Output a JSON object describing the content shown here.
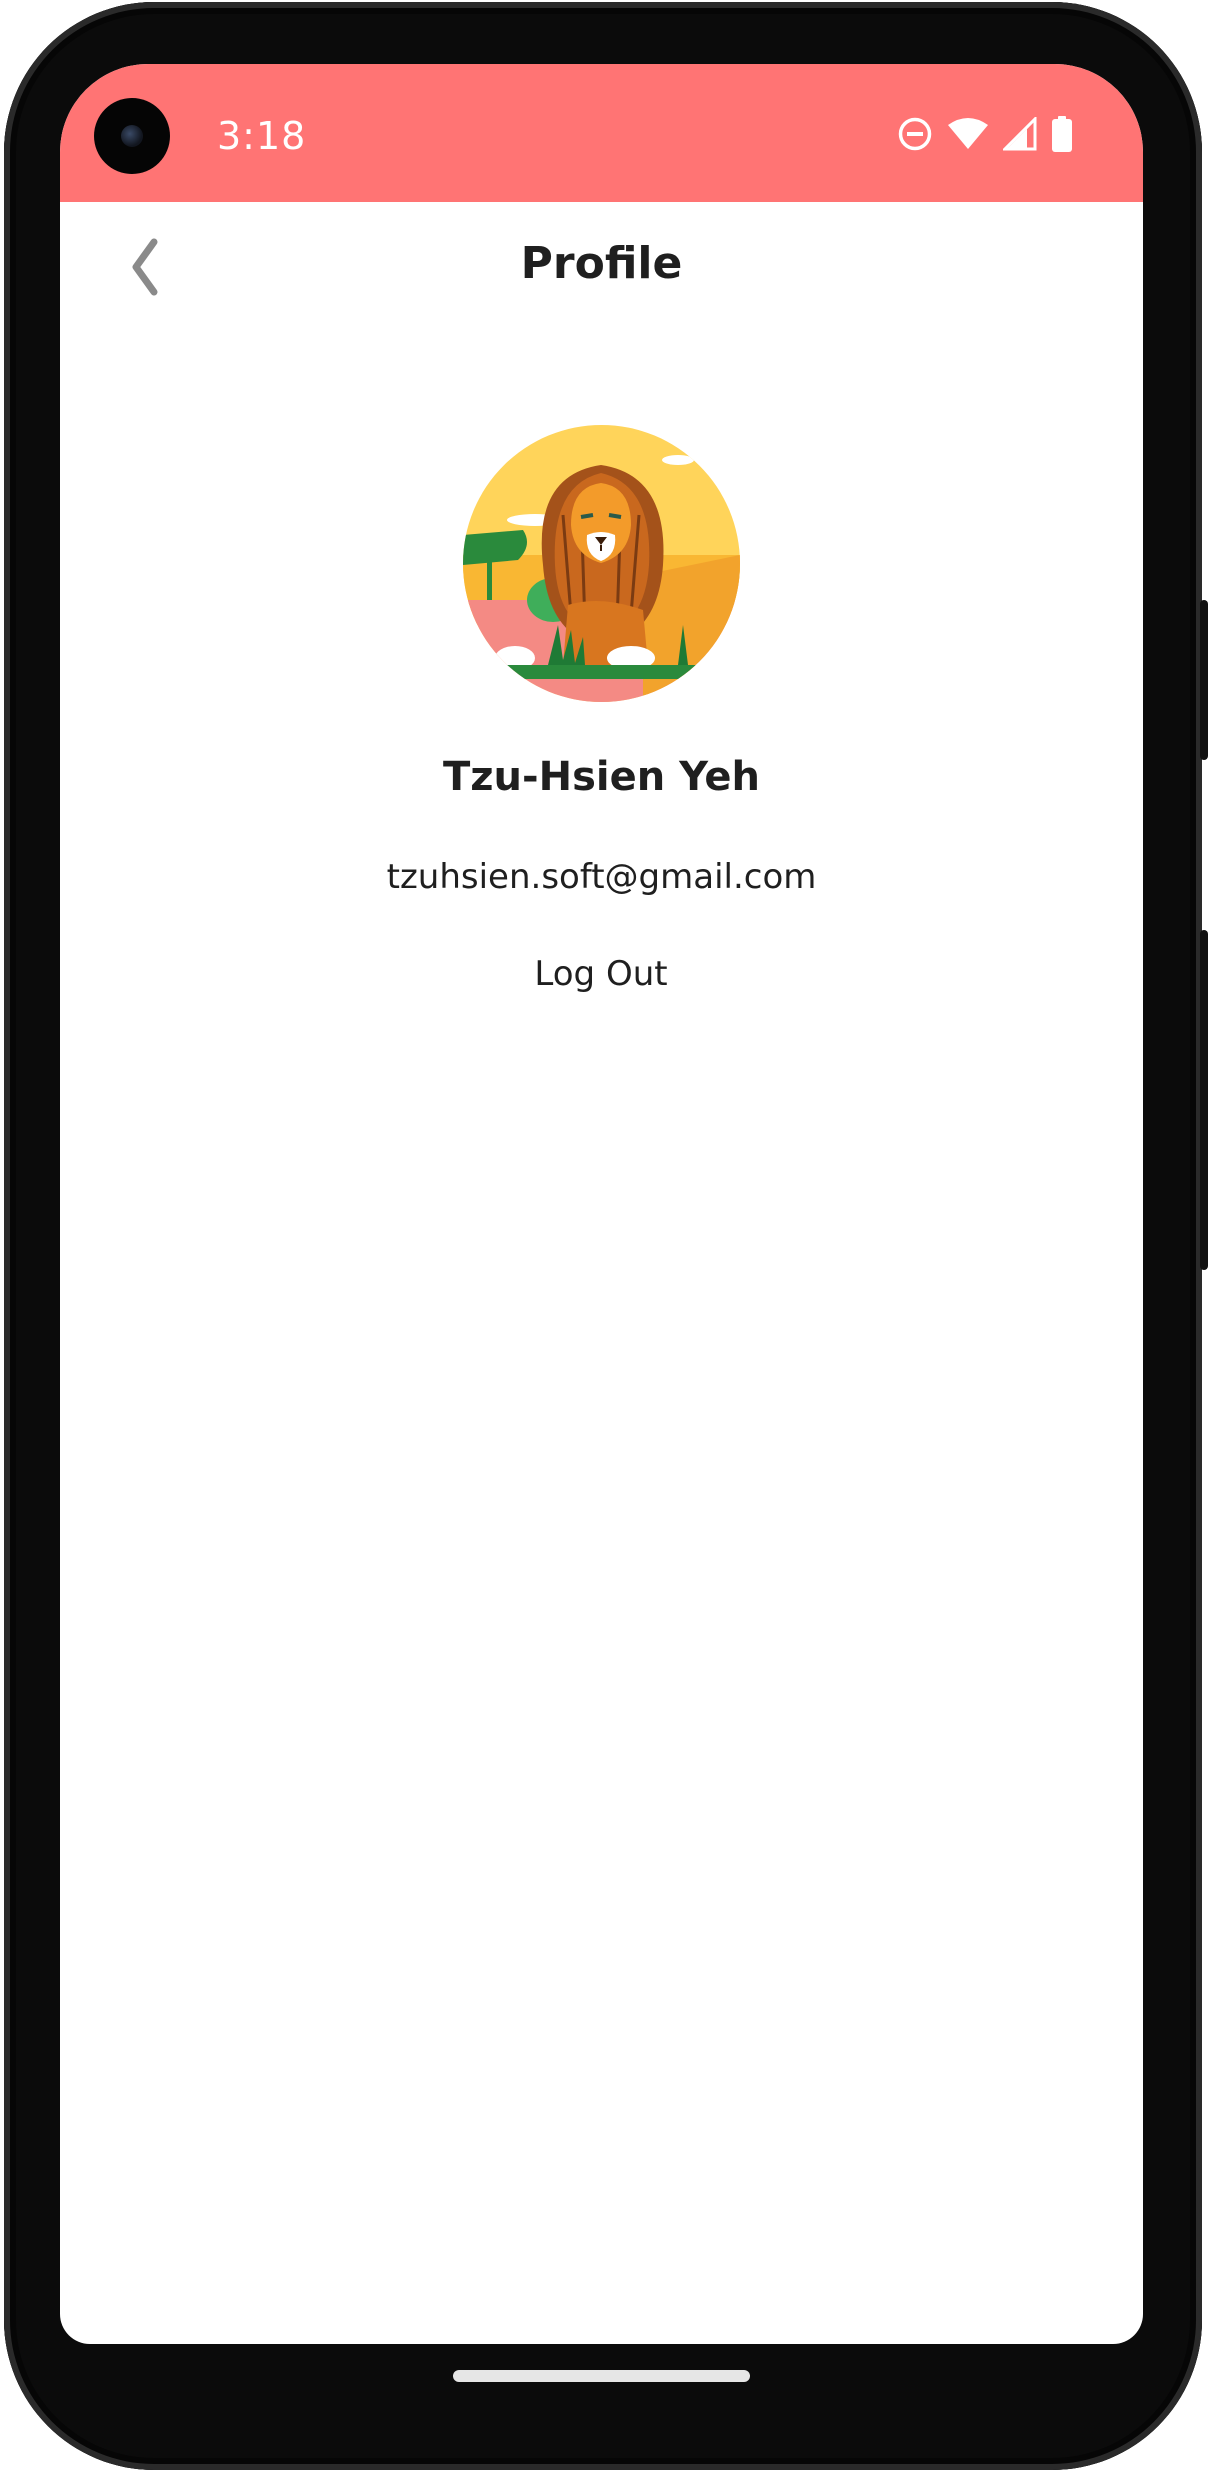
{
  "status_bar": {
    "time": "3:18",
    "background_color": "#ff7474",
    "icons": [
      "do-not-disturb-icon",
      "wifi-icon",
      "cell-signal-icon",
      "battery-icon"
    ]
  },
  "header": {
    "title": "Profile",
    "back_icon": "chevron-left-icon"
  },
  "profile": {
    "avatar_icon": "lion-avatar",
    "name": "Tzu-Hsien Yeh",
    "email": "tzuhsien.soft@gmail.com",
    "logout_label": "Log Out"
  },
  "colors": {
    "accent": "#ff7474",
    "text_primary": "#1f1f1f",
    "back_icon": "#8a8a8a"
  }
}
